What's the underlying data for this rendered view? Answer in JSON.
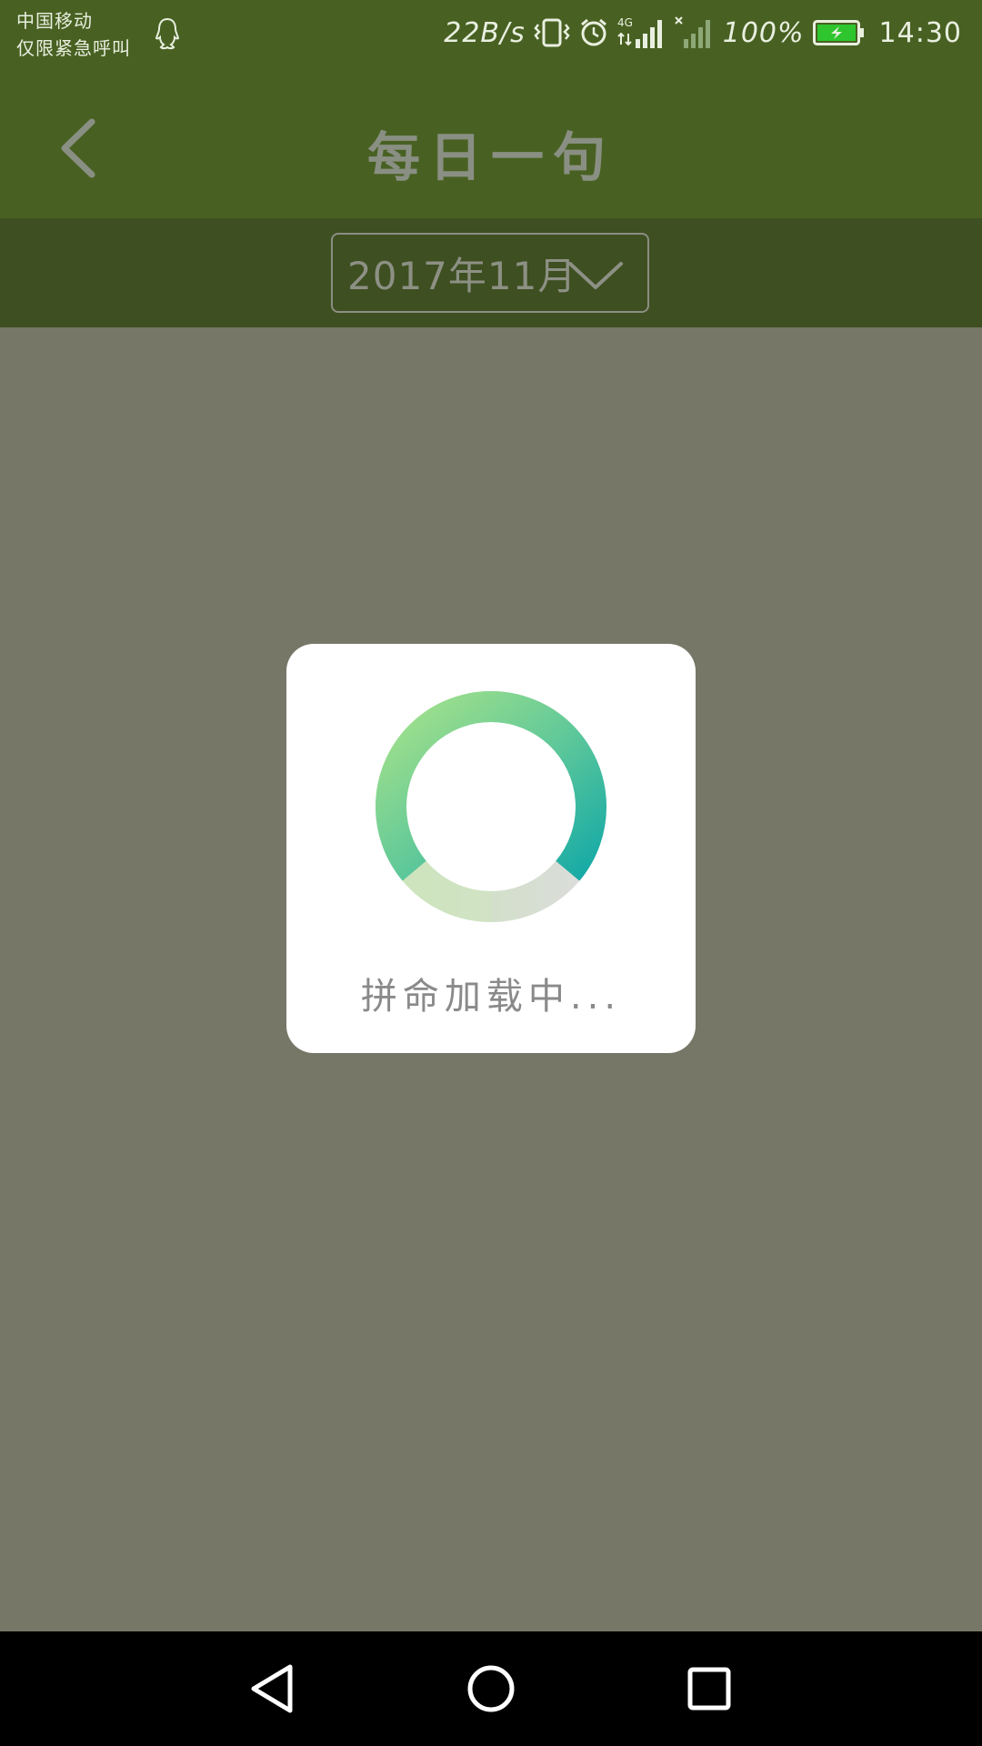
{
  "status_bar": {
    "carrier_line1": "中国移动",
    "carrier_line2": "仅限紧急呼叫",
    "net_speed": "22B/s",
    "battery_percent": "100%",
    "time": "14:30",
    "battery_level": 1.0,
    "icons": [
      "qq-icon",
      "vibrate-icon",
      "alarm-icon",
      "signal-4g-icon",
      "signal-no-sim-icon",
      "battery-charging-icon"
    ]
  },
  "header": {
    "title": "每日一句",
    "back_icon": "chevron-left-icon"
  },
  "month_selector": {
    "value": "2017年11月",
    "dropdown_icon": "chevron-down-icon"
  },
  "loading": {
    "text": "拼命加载中..."
  },
  "nav_bar": {
    "icons": [
      "nav-back-icon",
      "nav-home-icon",
      "nav-recent-icon"
    ]
  },
  "colors": {
    "header_bg": "#486122",
    "month_bar_bg": "#3e4f21",
    "overlay_bg": "#767766",
    "spinner_start": "#a6e28a",
    "spinner_end": "#16aaa6",
    "battery_green": "#2ec52e"
  }
}
